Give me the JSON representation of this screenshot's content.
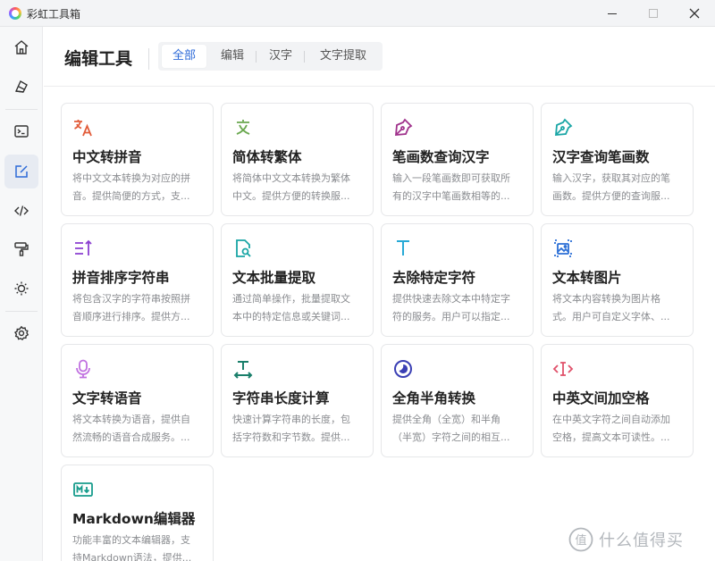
{
  "window": {
    "title": "彩虹工具箱",
    "controls": {
      "minimize": "minimize-icon",
      "maximize": "maximize-icon",
      "close": "close-icon"
    }
  },
  "sidebar": {
    "items": [
      {
        "icon": "home-icon",
        "active": false
      },
      {
        "icon": "eraser-icon",
        "active": false
      },
      {
        "icon": "terminal-icon",
        "active": false
      },
      {
        "icon": "edit-icon",
        "active": true
      },
      {
        "icon": "code-icon",
        "active": false
      },
      {
        "icon": "paint-roller-icon",
        "active": false
      },
      {
        "icon": "sun-icon",
        "active": false
      },
      {
        "icon": "settings-icon",
        "active": false
      }
    ]
  },
  "header": {
    "title": "编辑工具",
    "tabs": [
      {
        "label": "全部",
        "active": true
      },
      {
        "label": "编辑",
        "active": false
      },
      {
        "label": "汉字",
        "active": false
      },
      {
        "label": "文字提取",
        "active": false
      }
    ]
  },
  "cards": [
    {
      "title": "中文转拼音",
      "icon": "translate-icon",
      "color": "#e25c3a",
      "desc": [
        "将中文文本转换为对应的拼",
        "音。提供简便的方式，支..."
      ]
    },
    {
      "title": "简体转繁体",
      "icon": "translate-text-icon",
      "color": "#6aa84f",
      "desc": [
        "将简体中文文本转换为繁体",
        "中文。提供方便的转换服..."
      ]
    },
    {
      "title": "笔画数查询汉字",
      "icon": "pen-nib-icon",
      "color": "#a0328c",
      "desc": [
        "输入一段笔画数即可获取所",
        "有的汉字中笔画数相等的..."
      ]
    },
    {
      "title": "汉字查询笔画数",
      "icon": "pen-nib-icon",
      "color": "#1aa6a6",
      "desc": [
        "输入汉字，获取其对应的笔",
        "画数。提供方便的查询服..."
      ]
    },
    {
      "title": "拼音排序字符串",
      "icon": "sort-icon",
      "color": "#8b3fd1",
      "desc": [
        "将包含汉字的字符串按照拼",
        "音顺序进行排序。提供方..."
      ]
    },
    {
      "title": "文本批量提取",
      "icon": "file-search-icon",
      "color": "#1aa6a6",
      "desc": [
        "通过简单操作，批量提取文",
        "本中的特定信息或关键词..."
      ]
    },
    {
      "title": "去除特定字符",
      "icon": "text-t-icon",
      "color": "#27a9d6",
      "desc": [
        "提供快速去除文本中特定字",
        "符的服务。用户可以指定..."
      ]
    },
    {
      "title": "文本转图片",
      "icon": "image-convert-icon",
      "color": "#2b6fd6",
      "desc": [
        "将文本内容转换为图片格",
        "式。用户可自定义字体、..."
      ]
    },
    {
      "title": "文字转语音",
      "icon": "microphone-icon",
      "color": "#c070e0",
      "desc": [
        "将文本转换为语音，提供自",
        "然流畅的语音合成服务。..."
      ]
    },
    {
      "title": "字符串长度计算",
      "icon": "text-width-icon",
      "color": "#1a7f6b",
      "desc": [
        "快速计算字符串的长度，包",
        "括字符数和字节数。提供..."
      ]
    },
    {
      "title": "全角半角转换",
      "icon": "half-moon-icon",
      "color": "#3a3fb4",
      "desc": [
        "提供全角（全宽）和半角",
        "（半宽）字符之间的相互..."
      ]
    },
    {
      "title": "中英文间加空格",
      "icon": "text-cursor-icon",
      "color": "#e0506a",
      "desc": [
        "在中英文字符之间自动添加",
        "空格，提高文本可读性。..."
      ]
    },
    {
      "title": "Markdown编辑器",
      "icon": "markdown-icon",
      "color": "#179c8c",
      "desc": [
        "功能丰富的文本编辑器，支",
        "持Markdown语法，提供..."
      ]
    }
  ],
  "watermark": {
    "text": "什么值得买",
    "mark": "值"
  }
}
